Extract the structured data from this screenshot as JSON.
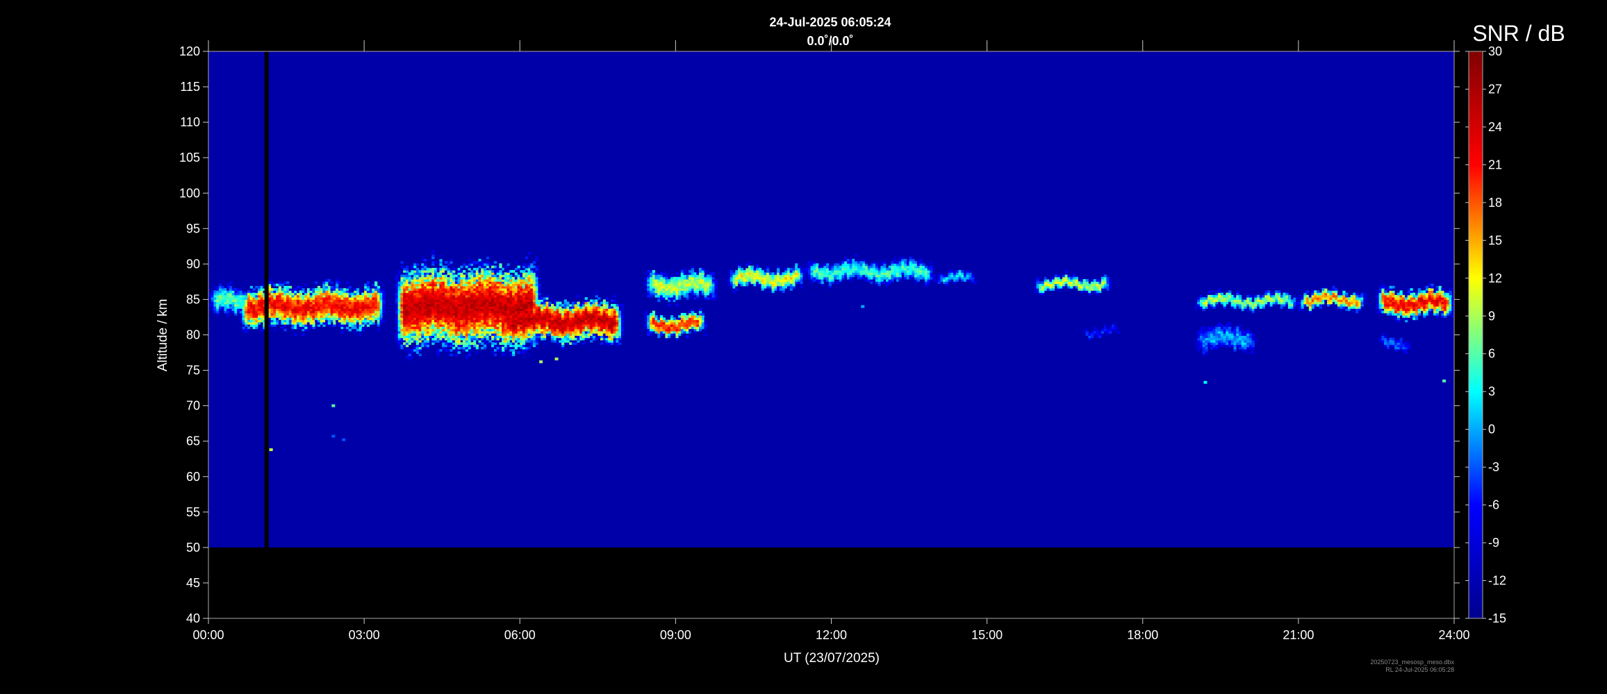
{
  "chart_data": {
    "type": "heatmap",
    "title": "24-Jul-2025 06:05:24",
    "subtitle": "0.0˚/0.0˚",
    "xlabel": "UT (23/07/2025)",
    "ylabel": "Altitude / km",
    "x_ticks": [
      "00:00",
      "03:00",
      "06:00",
      "09:00",
      "12:00",
      "15:00",
      "18:00",
      "21:00",
      "24:00"
    ],
    "xlim_hours": [
      0,
      24
    ],
    "ylim_km": [
      40,
      120
    ],
    "y_ticks": [
      40,
      45,
      50,
      55,
      60,
      65,
      70,
      75,
      80,
      85,
      90,
      95,
      100,
      105,
      110,
      115,
      120
    ],
    "data_altitude_range_km": [
      50,
      120
    ],
    "background_snr_db": -13,
    "data_gap_hours": [
      1.08,
      1.16
    ],
    "colorbar": {
      "label": "SNR / dB",
      "range": [
        -15,
        30
      ],
      "ticks": [
        30,
        27,
        24,
        21,
        18,
        15,
        12,
        9,
        6,
        3,
        0,
        -3,
        -6,
        -9,
        -12,
        -15
      ],
      "colormap": [
        "#00008f",
        "#0000ff",
        "#00ffff",
        "#ffff00",
        "#ff0000",
        "#800000"
      ]
    },
    "echo_layers": [
      {
        "t_start": 0.0,
        "t_end": 0.9,
        "alt_center": 84.8,
        "thickness": 2.0,
        "snr_db": 6
      },
      {
        "t_start": 0.6,
        "t_end": 3.4,
        "alt_center": 84.0,
        "thickness": 3.0,
        "snr_db": 22
      },
      {
        "t_start": 3.6,
        "t_end": 6.4,
        "alt_center": 84.0,
        "thickness": 6.0,
        "snr_db": 25
      },
      {
        "t_start": 5.6,
        "t_end": 8.0,
        "alt_center": 82.0,
        "thickness": 3.0,
        "snr_db": 25
      },
      {
        "t_start": 8.4,
        "t_end": 9.6,
        "alt_center": 81.5,
        "thickness": 1.5,
        "snr_db": 20
      },
      {
        "t_start": 8.4,
        "t_end": 9.8,
        "alt_center": 87.0,
        "thickness": 2.0,
        "snr_db": 10
      },
      {
        "t_start": 10.0,
        "t_end": 11.5,
        "alt_center": 88.0,
        "thickness": 1.5,
        "snr_db": 12
      },
      {
        "t_start": 11.5,
        "t_end": 14.0,
        "alt_center": 89.0,
        "thickness": 1.5,
        "snr_db": 5
      },
      {
        "t_start": 14.0,
        "t_end": 14.8,
        "alt_center": 88.0,
        "thickness": 0.8,
        "snr_db": 2
      },
      {
        "t_start": 15.9,
        "t_end": 17.4,
        "alt_center": 87.2,
        "thickness": 1.0,
        "snr_db": 10
      },
      {
        "t_start": 19.0,
        "t_end": 21.0,
        "alt_center": 84.8,
        "thickness": 1.0,
        "snr_db": 9
      },
      {
        "t_start": 21.0,
        "t_end": 22.3,
        "alt_center": 85.0,
        "thickness": 1.2,
        "snr_db": 16
      },
      {
        "t_start": 22.5,
        "t_end": 24.0,
        "alt_center": 84.5,
        "thickness": 2.0,
        "snr_db": 22
      },
      {
        "t_start": 19.0,
        "t_end": 20.2,
        "alt_center": 79.5,
        "thickness": 1.8,
        "snr_db": 0
      },
      {
        "t_start": 22.5,
        "t_end": 23.2,
        "alt_center": 78.8,
        "thickness": 0.8,
        "snr_db": -2
      },
      {
        "t_start": 16.8,
        "t_end": 17.6,
        "alt_center": 80.5,
        "thickness": 0.6,
        "snr_db": -4
      }
    ],
    "isolated_echoes": [
      {
        "t": 2.4,
        "alt": 70.0,
        "snr_db": 6
      },
      {
        "t": 2.4,
        "alt": 65.7,
        "snr_db": -3
      },
      {
        "t": 2.6,
        "alt": 65.2,
        "snr_db": -3
      },
      {
        "t": 1.2,
        "alt": 63.8,
        "snr_db": 10
      },
      {
        "t": 6.4,
        "alt": 76.2,
        "snr_db": 9
      },
      {
        "t": 6.7,
        "alt": 76.6,
        "snr_db": 9
      },
      {
        "t": 19.2,
        "alt": 73.3,
        "snr_db": 3
      },
      {
        "t": 23.8,
        "alt": 73.5,
        "snr_db": 6
      },
      {
        "t": 12.6,
        "alt": 84.0,
        "snr_db": 0
      }
    ]
  },
  "footer": {
    "line1": "20250723_mesosp_meso.dbx",
    "line2": "RL 24-Jul-2025 06:05:28"
  }
}
